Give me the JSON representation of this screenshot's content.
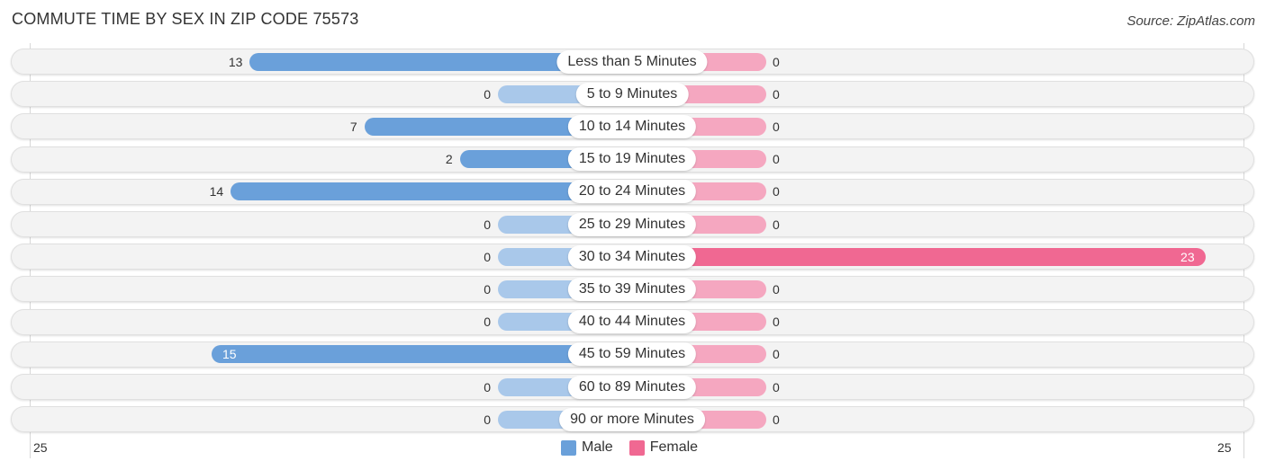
{
  "title": "COMMUTE TIME BY SEX IN ZIP CODE 75573",
  "source": "Source: ZipAtlas.com",
  "colors": {
    "male": "#6aa0da",
    "male_light": "#a9c8ea",
    "female": "#f06892",
    "female_light": "#f5a7c0"
  },
  "chart_data": {
    "type": "bar",
    "orientation": "horizontal-diverging",
    "title": "COMMUTE TIME BY SEX IN ZIP CODE 75573",
    "categories": [
      "Less than 5 Minutes",
      "5 to 9 Minutes",
      "10 to 14 Minutes",
      "15 to 19 Minutes",
      "20 to 24 Minutes",
      "25 to 29 Minutes",
      "30 to 34 Minutes",
      "35 to 39 Minutes",
      "40 to 44 Minutes",
      "45 to 59 Minutes",
      "60 to 89 Minutes",
      "90 or more Minutes"
    ],
    "series": [
      {
        "name": "Male",
        "values": [
          13,
          0,
          7,
          2,
          14,
          0,
          0,
          0,
          0,
          15,
          0,
          0
        ]
      },
      {
        "name": "Female",
        "values": [
          0,
          0,
          0,
          0,
          0,
          0,
          23,
          0,
          0,
          0,
          0,
          0
        ]
      }
    ],
    "xlim": [
      25,
      25
    ],
    "axis_tick_labels": {
      "left": "25",
      "right": "25"
    },
    "legend": {
      "placement": "bottom-center",
      "entries": [
        "Male",
        "Female"
      ]
    },
    "grid": false
  }
}
